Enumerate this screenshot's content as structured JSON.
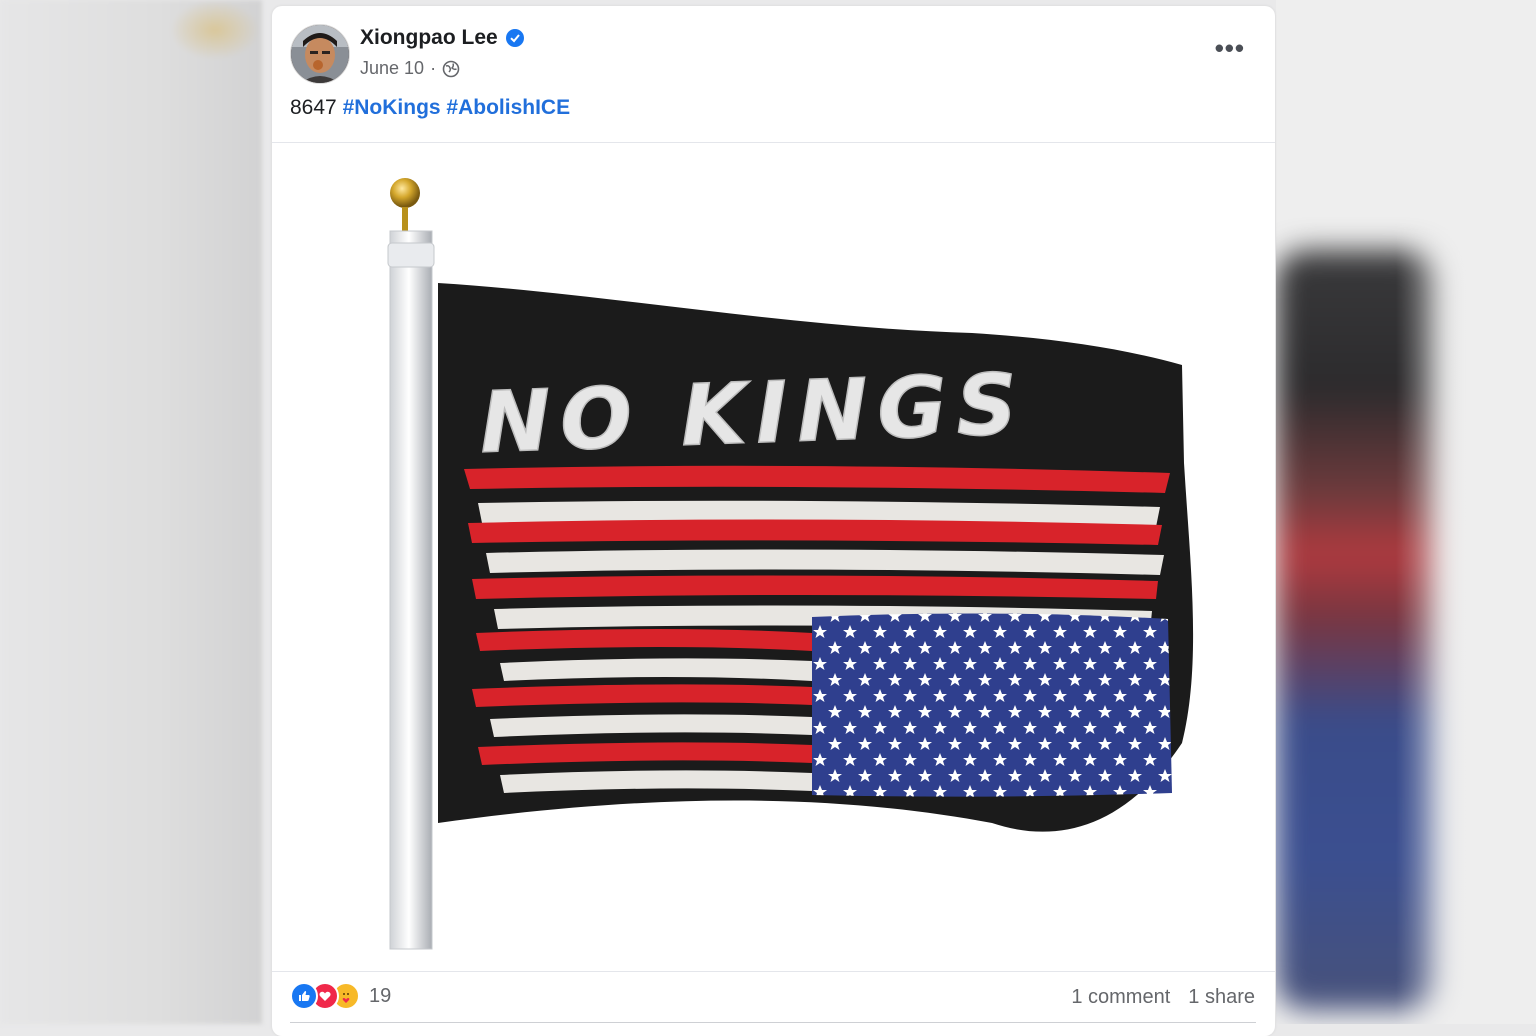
{
  "post": {
    "author": "Xiongpao Lee",
    "date": "June 10",
    "date_separator": "·",
    "privacy_icon": "globe-icon",
    "verified_icon": "verified-badge-icon",
    "more_icon": "more-options-icon",
    "more_label": "•••",
    "text_prefix": "8647",
    "hashtags": [
      "#NoKings",
      "#AbolishICE"
    ],
    "image_text": "NO KINGS"
  },
  "footer": {
    "reaction_icons": [
      "like-icon",
      "love-icon",
      "care-icon"
    ],
    "reaction_count": "19",
    "comments": "1 comment",
    "shares": "1 share"
  },
  "colors": {
    "hashtag": "#216fdb",
    "flag_black": "#1b1b1b",
    "flag_red": "#d8232a",
    "flag_blue": "#2f3f8e",
    "like": "#1877f2",
    "love": "#f0284a",
    "care": "#f7b928"
  }
}
